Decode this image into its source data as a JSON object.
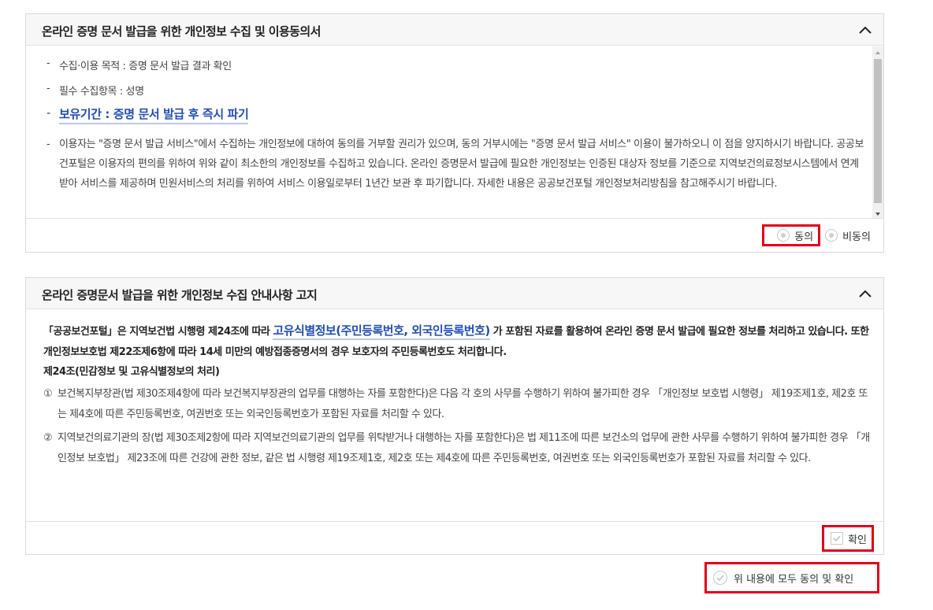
{
  "consent_panel": {
    "title": "온라인 증명 문서 발급을 위한 개인정보 수집 및 이용동의서",
    "items": [
      {
        "dash": "-",
        "text": "수집·이용 목적 : 증명 문서 발급 결과 확인"
      },
      {
        "dash": "-",
        "text": "필수 수집항목 : 성명"
      },
      {
        "dash": "-",
        "text": "보유기간 : 증명 문서 발급 후 즉시 파기"
      },
      {
        "dash": "-",
        "text": "이용자는 \"증명 문서 발급 서비스\"에서 수집하는 개인정보에 대하여 동의를 거부할 권리가 있으며, 동의 거부시에는 \"증명 문서 발급 서비스\" 이용이 불가하오니 이 점을 양지하시기 바랍니다. 공공보건포털은 이용자의 편의를 위하여 위와 같이 최소한의 개인정보를 수집하고 있습니다. 온라인 증명문서 발급에 필요한 개인정보는 인증된 대상자 정보를 기준으로 지역보건의료정보시스템에서 연계받아 서비스를 제공하며 민원서비스의 처리를 위하여 서비스 이용일로부터 1년간 보관 후 파기합니다. 자세한 내용은 공공보건포털 개인정보처리방침을 참고해주시기 바랍니다."
      }
    ],
    "agree_label": "동의",
    "disagree_label": "비동의"
  },
  "notice_panel": {
    "title": "온라인 증명문서 발급을 위한 개인정보 수집 안내사항 고지",
    "lead_prefix": "「공공보건포털」은 지역보건법 시행령 제24조에 따라 ",
    "lead_highlight": "고유식별정보(주민등록번호, 외국인등록번호)",
    "lead_suffix": " 가 포함된 자료를 활용하여 온라인 증명 문서 발급에 필요한 정보를 처리하고 있습니다. 또한 개인정보보호법 제22조제6항에 따라 14세 미만의 예방접종증명서의 경우 보호자의 주민등록번호도 처리합니다.",
    "article_title": "제24조(민감정보 및 고유식별정보의 처리)",
    "clauses": [
      {
        "num": "①",
        "text": "보건복지부장관(법 제30조제4항에 따라 보건복지부장관의 업무를 대행하는 자를 포함한다)은 다음 각 호의 사무를 수행하기 위하여 불가피한 경우 「개인정보 보호법 시행령」 제19조제1호, 제2호 또는 제4호에 따른 주민등록번호, 여권번호 또는 외국인등록번호가 포함된 자료를 처리할 수 있다."
      },
      {
        "num": "②",
        "text": "지역보건의료기관의 장(법 제30조제2항에 따라 지역보건의료기관의 업무를 위탁받거나 대행하는 자를 포함한다)은 법 제11조에 따른 보건소의 업무에 관한 사무를 수행하기 위하여 불가피한 경우 「개인정보 보호법」 제23조에 따른 건강에 관한 정보, 같은 법 시행령 제19조제1호, 제2호 또는 제4호에 따른 주민등록번호, 여권번호 또는 외국인등록번호가 포함된 자료를 처리할 수 있다."
      }
    ],
    "confirm_label": "확인"
  },
  "all_agree_label": "위 내용에 모두 동의 및 확인",
  "colors": {
    "highlight_text": "#1f4db8",
    "highlight_underline": "#b9c8ea",
    "red_outline": "#e3001b",
    "header_bg": "#f7f7f7"
  }
}
